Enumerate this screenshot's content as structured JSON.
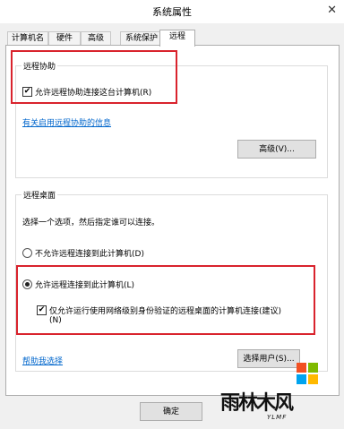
{
  "window": {
    "title": "系统属性",
    "close_glyph": "✕"
  },
  "tabs": [
    {
      "label": "计算机名"
    },
    {
      "label": "硬件"
    },
    {
      "label": "高级"
    },
    {
      "label": "系统保护"
    },
    {
      "label": "远程",
      "active": true
    }
  ],
  "remote_assistance": {
    "group_title": "远程协助",
    "allow_checkbox": {
      "label": "允许远程协助连接这台计算机(R)",
      "checked": true
    },
    "info_link": "有关启用远程协助的信息",
    "advanced_button": "高级(V)..."
  },
  "remote_desktop": {
    "group_title": "远程桌面",
    "instruction": "选择一个选项，然后指定谁可以连接。",
    "options": [
      {
        "label": "不允许远程连接到此计算机(D)",
        "selected": false
      },
      {
        "label": "允许远程连接到此计算机(L)",
        "selected": true
      }
    ],
    "nla_checkbox": {
      "label_line1": "仅允许运行使用网络级别身份验证的远程桌面的计算机连接(建议)",
      "label_line2": "(N)",
      "checked": true
    },
    "help_link": "帮助我选择",
    "select_users_button": "选择用户(S)..."
  },
  "footer": {
    "ok_button": "确定"
  },
  "watermark": {
    "text": "雨林木风",
    "sub": "YLMF",
    "colors": [
      "#f25022",
      "#7fba00",
      "#00a4ef",
      "#ffb900"
    ]
  },
  "highlight_color": "#d9232d"
}
